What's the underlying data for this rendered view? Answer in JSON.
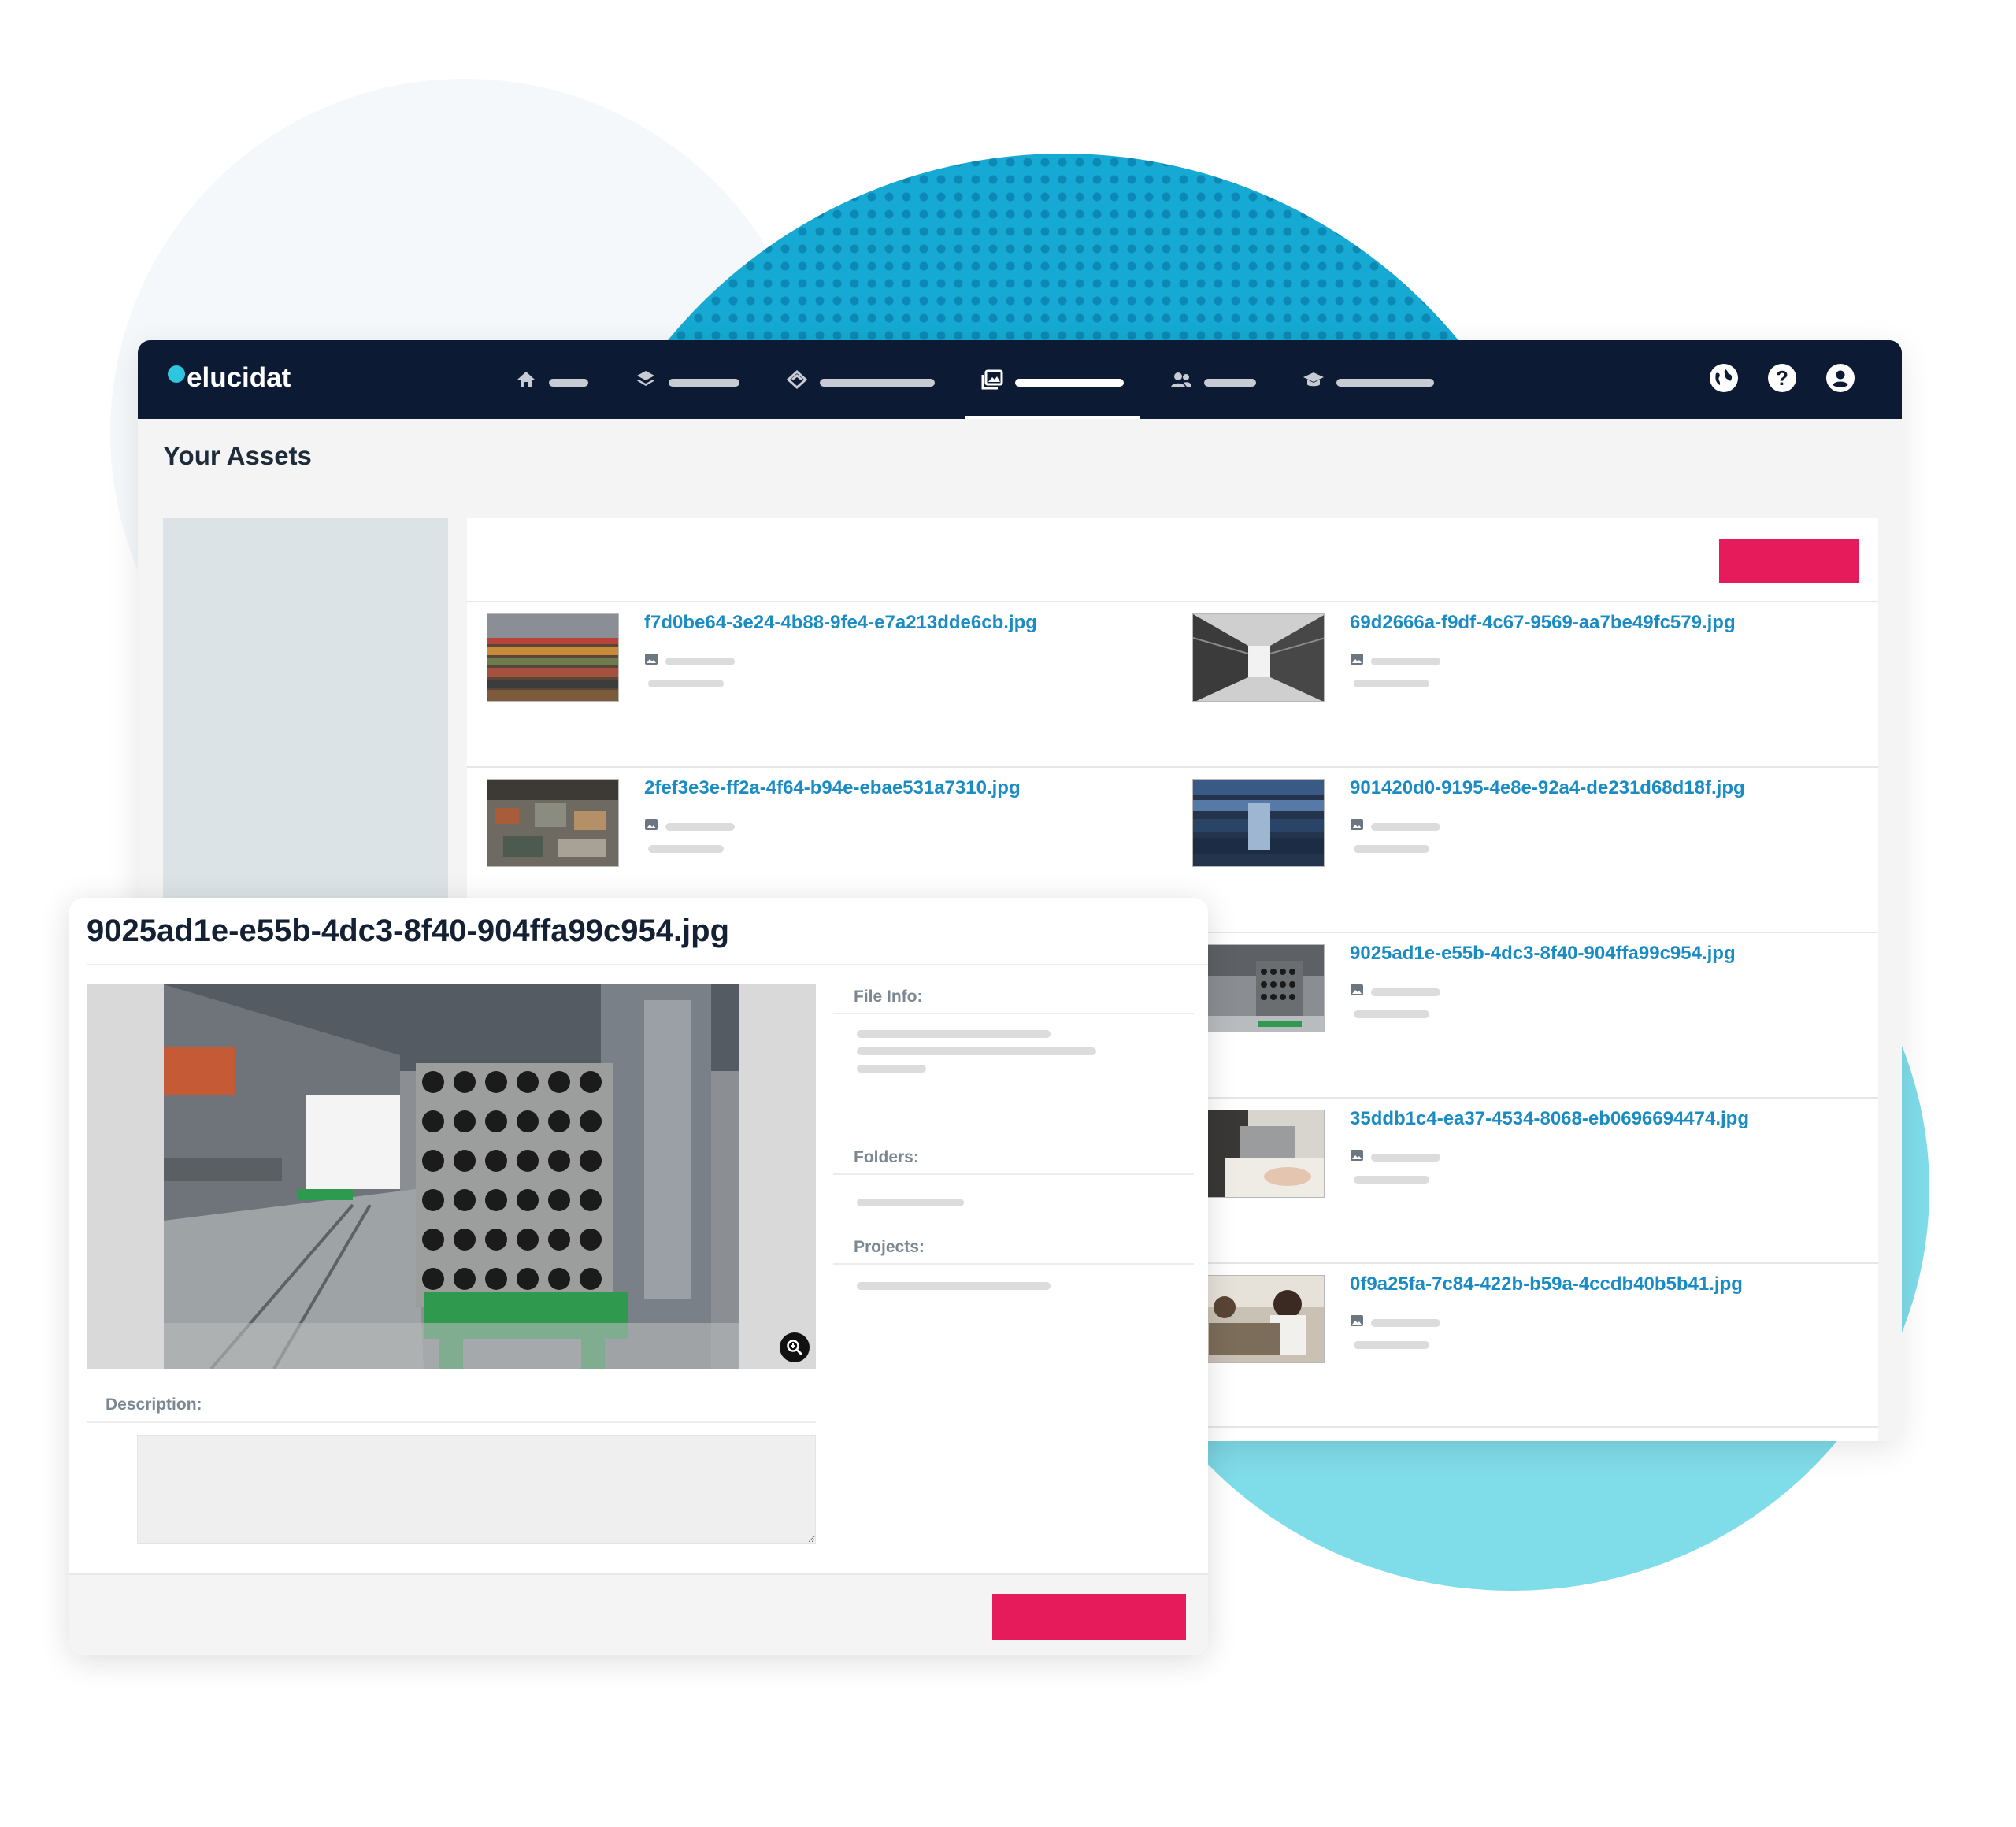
{
  "app": {
    "logo_text": "elucidat",
    "page_title": "Your Assets"
  },
  "nav": {
    "items": [
      {
        "icon": "home-icon",
        "active": false
      },
      {
        "icon": "layers-icon",
        "active": false
      },
      {
        "icon": "stack-icon",
        "active": false
      },
      {
        "icon": "image-gallery-icon",
        "active": true
      },
      {
        "icon": "users-icon",
        "active": false
      },
      {
        "icon": "graduation-cap-icon",
        "active": false
      }
    ],
    "right_icons": [
      "globe-icon",
      "help-icon",
      "user-icon"
    ],
    "help_glyph": "?"
  },
  "assets": [
    {
      "name": "f7d0be64-3e24-4b88-9fe4-e7a213dde6cb.jpg"
    },
    {
      "name": "69d2666a-f9df-4c67-9569-aa7be49fc579.jpg"
    },
    {
      "name": "2fef3e3e-ff2a-4f64-b94e-ebae531a7310.jpg"
    },
    {
      "name": "901420d0-9195-4e8e-92a4-de231d68d18f.jpg"
    },
    {
      "name": ""
    },
    {
      "name": "9025ad1e-e55b-4dc3-8f40-904ffa99c954.jpg"
    },
    {
      "name": ""
    },
    {
      "name": "35ddb1c4-ea37-4534-8068-eb0696694474.jpg"
    },
    {
      "name": ""
    },
    {
      "name": "0f9a25fa-7c84-422b-b59a-4ccdb40b5b41.jpg"
    }
  ],
  "detail": {
    "title": "9025ad1e-e55b-4dc3-8f40-904ffa99c954.jpg",
    "file_info_label": "File Info:",
    "folders_label": "Folders:",
    "projects_label": "Projects:",
    "description_label": "Description:",
    "description_value": ""
  },
  "colors": {
    "navbar": "#0c1b33",
    "accent": "#e51b5b",
    "link": "#1a8cc3",
    "brand_dot": "#2ec5e0"
  }
}
